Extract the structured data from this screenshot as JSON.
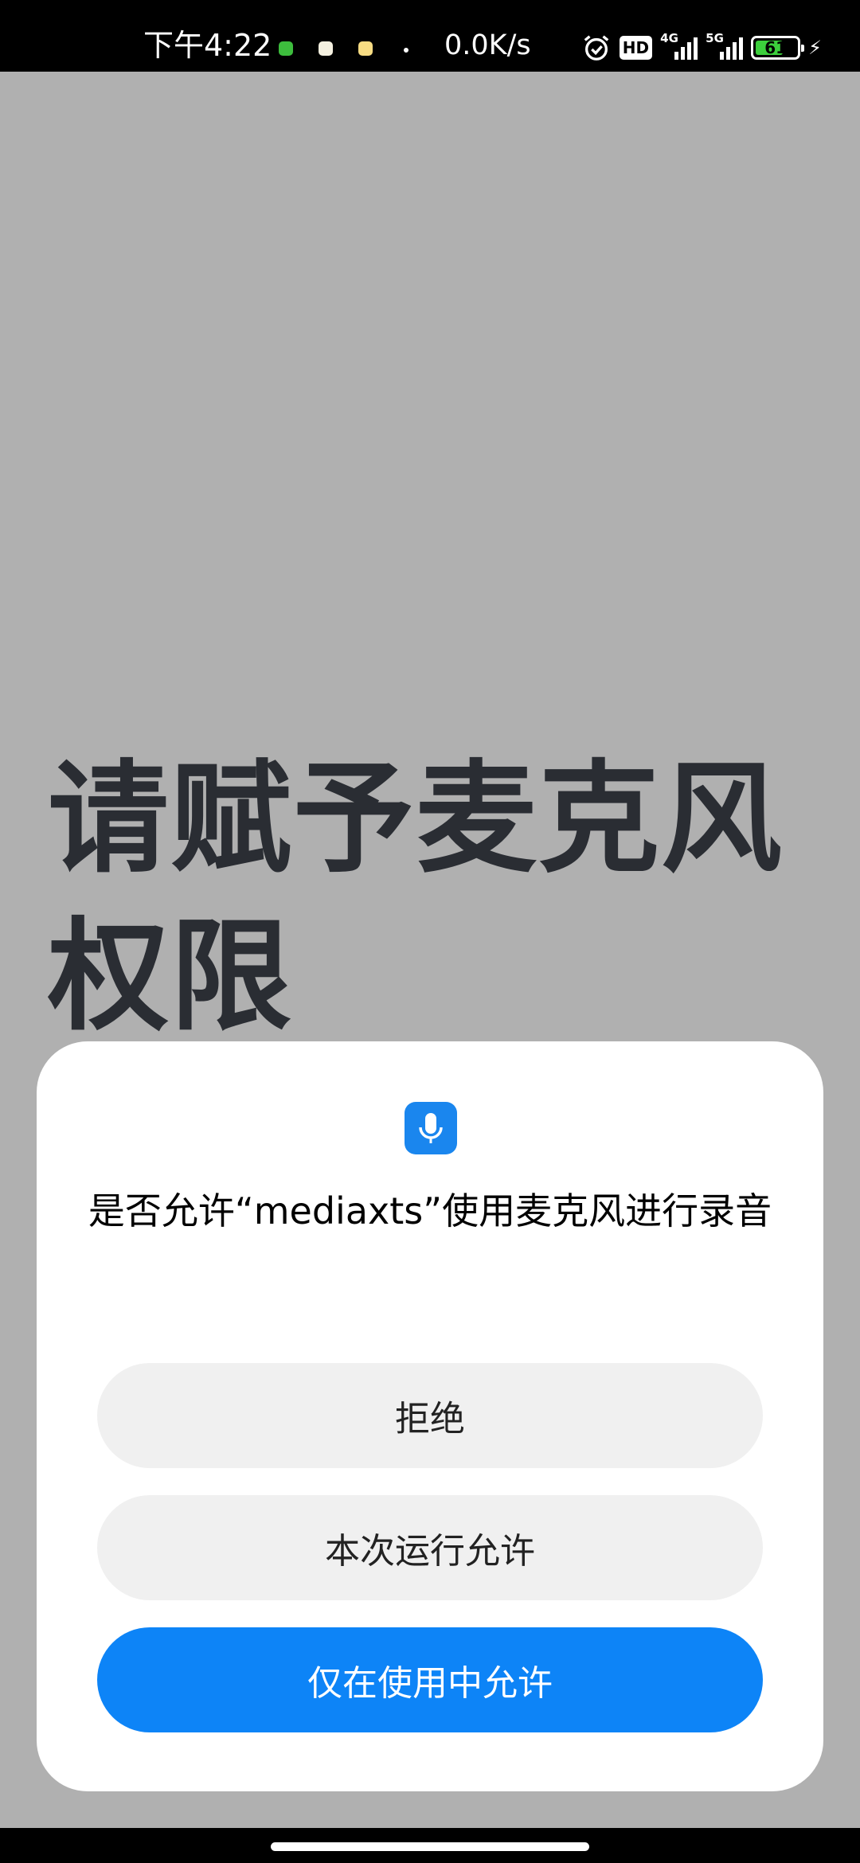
{
  "status_bar": {
    "time": "下午4:22",
    "net_speed": "0.0K/s",
    "hd_label": "HD",
    "sim1_label": "4G",
    "sim2_label": "5G",
    "battery_percent": "61",
    "icons": [
      "wechat-icon",
      "message-icon",
      "notification-icon",
      "dot-icon",
      "alarm-icon",
      "hd-icon",
      "signal-4g-icon",
      "signal-5g-icon",
      "battery-icon",
      "charging-icon"
    ]
  },
  "background": {
    "title": "请赋予麦克风权限"
  },
  "dialog": {
    "icon": "microphone-icon",
    "message": "是否允许“mediaxts”使用麦克风进行录音",
    "buttons": {
      "deny": "拒绝",
      "allow_once": "本次运行允许",
      "allow_while_using": "仅在使用中允许"
    }
  },
  "colors": {
    "accent": "#0d84f7",
    "scrim": "#b0b0b0",
    "secondary_button": "#f0f0f0",
    "title_text": "#2a2d33"
  }
}
